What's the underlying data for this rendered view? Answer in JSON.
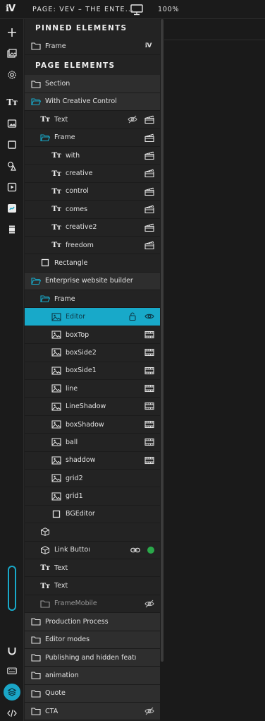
{
  "app": {
    "logo": "ℹV"
  },
  "topbar": {
    "page_title": "PAGE: VEV – THE ENTE...",
    "zoom": "100%"
  },
  "colors": {
    "accent": "#18a9c9",
    "selected_row": "#18a9c9",
    "group_row": "#2e2e2e",
    "panel_bg": "#232323",
    "status_green": "#2aa84a"
  },
  "toolbar": {
    "tools": [
      "add-icon",
      "images-icon",
      "settings-icon",
      "text-tool-icon",
      "image-tool-icon",
      "rectangle-tool-icon",
      "shapes-tool-icon",
      "video-tool-icon",
      "widget-tool-icon",
      "layout-tool-icon",
      "magnet-icon",
      "keyboard-icon",
      "layers-icon",
      "code-icon"
    ],
    "text_tool_glyph": "Tт"
  },
  "layers": {
    "pinned_header": "PINNED ELEMENTS",
    "pinned": [
      {
        "label": "Frame",
        "badge": "ℹV"
      }
    ],
    "page_header": "PAGE ELEMENTS",
    "rows": [
      {
        "label": "Section",
        "type": "folder",
        "depth": 0,
        "group": true,
        "actions": []
      },
      {
        "label": "With Creative Control",
        "type": "folder-open",
        "depth": 0,
        "group": true,
        "actions": []
      },
      {
        "label": "Text",
        "type": "text",
        "depth": 1,
        "group": false,
        "actions": [
          "eye-off",
          "clapper"
        ]
      },
      {
        "label": "Frame",
        "type": "folder-open",
        "depth": 1,
        "group": false,
        "actions": [
          "clapper"
        ]
      },
      {
        "label": "with",
        "type": "text",
        "depth": 2,
        "group": false,
        "actions": [
          "clapper"
        ]
      },
      {
        "label": "creative",
        "type": "text",
        "depth": 2,
        "group": false,
        "actions": [
          "clapper"
        ]
      },
      {
        "label": "control",
        "type": "text",
        "depth": 2,
        "group": false,
        "actions": [
          "clapper"
        ]
      },
      {
        "label": "comes",
        "type": "text",
        "depth": 2,
        "group": false,
        "actions": [
          "clapper"
        ]
      },
      {
        "label": "creative2",
        "type": "text",
        "depth": 2,
        "group": false,
        "actions": [
          "clapper"
        ]
      },
      {
        "label": "freedom",
        "type": "text",
        "depth": 2,
        "group": false,
        "actions": [
          "clapper"
        ]
      },
      {
        "label": "Rectangle",
        "type": "rect",
        "depth": 1,
        "group": false,
        "actions": []
      },
      {
        "label": "Enterprise website builder",
        "type": "folder-open",
        "depth": 0,
        "group": true,
        "actions": []
      },
      {
        "label": "Frame",
        "type": "folder-open",
        "depth": 1,
        "group": false,
        "actions": []
      },
      {
        "label": "Editor",
        "type": "image",
        "depth": 2,
        "group": false,
        "selected": true,
        "actions": [
          "lock",
          "eye"
        ]
      },
      {
        "label": "boxTop",
        "type": "image",
        "depth": 2,
        "group": false,
        "actions": [
          "film"
        ]
      },
      {
        "label": "boxSide2",
        "type": "image",
        "depth": 2,
        "group": false,
        "actions": [
          "film"
        ]
      },
      {
        "label": "boxSide1",
        "type": "image",
        "depth": 2,
        "group": false,
        "actions": [
          "film"
        ]
      },
      {
        "label": "line",
        "type": "image",
        "depth": 2,
        "group": false,
        "actions": [
          "film"
        ]
      },
      {
        "label": "LineShadow",
        "type": "image",
        "depth": 2,
        "group": false,
        "actions": [
          "film"
        ]
      },
      {
        "label": "boxShadow",
        "type": "image",
        "depth": 2,
        "group": false,
        "actions": [
          "film"
        ]
      },
      {
        "label": "ball",
        "type": "image",
        "depth": 2,
        "group": false,
        "actions": [
          "film"
        ]
      },
      {
        "label": "shaddow",
        "type": "image",
        "depth": 2,
        "group": false,
        "actions": [
          "film"
        ]
      },
      {
        "label": "grid2",
        "type": "image",
        "depth": 2,
        "group": false,
        "actions": []
      },
      {
        "label": "grid1",
        "type": "image",
        "depth": 2,
        "group": false,
        "actions": []
      },
      {
        "label": "BGEditor",
        "type": "rect",
        "depth": 2,
        "group": false,
        "actions": []
      },
      {
        "label": "",
        "type": "cube",
        "depth": 1,
        "group": false,
        "actions": []
      },
      {
        "label": "Link Buttoı",
        "type": "cube",
        "depth": 1,
        "group": false,
        "actions": [
          "link",
          "dot"
        ]
      },
      {
        "label": "Text",
        "type": "text",
        "depth": 1,
        "group": false,
        "actions": []
      },
      {
        "label": "Text",
        "type": "text",
        "depth": 1,
        "group": false,
        "actions": []
      },
      {
        "label": "FrameMobile",
        "type": "folder",
        "depth": 1,
        "group": false,
        "dim": true,
        "actions": [
          "eye-off"
        ]
      },
      {
        "label": "Production Process",
        "type": "folder",
        "depth": 0,
        "group": true,
        "actions": []
      },
      {
        "label": "Editor modes",
        "type": "folder",
        "depth": 0,
        "group": true,
        "actions": []
      },
      {
        "label": "Publishing and hidden featı",
        "type": "folder",
        "depth": 0,
        "group": true,
        "actions": []
      },
      {
        "label": "animation",
        "type": "folder",
        "depth": 0,
        "group": true,
        "actions": []
      },
      {
        "label": "Quote",
        "type": "folder",
        "depth": 0,
        "group": true,
        "actions": []
      },
      {
        "label": "CTA",
        "type": "folder",
        "depth": 0,
        "group": true,
        "actions": [
          "eye-off"
        ]
      }
    ]
  }
}
